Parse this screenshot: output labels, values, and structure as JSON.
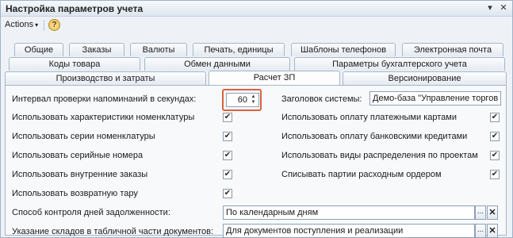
{
  "window": {
    "title": "Настройка параметров учета",
    "pin_icon": "pin-icon",
    "close_icon": "close-icon"
  },
  "toolbar": {
    "actions_label": "Actions",
    "help_label": "?"
  },
  "tabs_row1": [
    "Общие",
    "Заказы",
    "Валюты",
    "Печать, единицы",
    "Шаблоны телефонов",
    "Электронная почта"
  ],
  "tabs_row2": [
    "Коды товара",
    "Обмен данными",
    "Параметры бухгалтерского учета"
  ],
  "tabs_row3": [
    "Производство и затраты",
    "Расчет ЗП",
    "Версионирование"
  ],
  "form": {
    "reminder_interval_label": "Интервал проверки напоминаний в секундах:",
    "reminder_interval_value": "60",
    "system_title_label": "Заголовок системы:",
    "system_title_value": "Демо-база \"Управление торгов",
    "left_checks": [
      {
        "label": "Использовать характеристики номенклатуры",
        "checked": true
      },
      {
        "label": "Использовать серии номенклатуры",
        "checked": true
      },
      {
        "label": "Использовать серийные номера",
        "checked": true
      },
      {
        "label": "Использовать внутренние заказы",
        "checked": true
      },
      {
        "label": "Использовать возвратную тару",
        "checked": true
      }
    ],
    "right_checks": [
      {
        "label": "Использовать оплату платежными картами",
        "checked": true
      },
      {
        "label": "Использовать оплату банковскими кредитами",
        "checked": true
      },
      {
        "label": "Использовать виды распределения по проектам",
        "checked": true
      },
      {
        "label": "Списывать партии расходным ордером",
        "checked": true
      }
    ],
    "debt_control_label": "Способ контроля дней задолженности:",
    "debt_control_value": "По календарным дням",
    "warehouse_label": "Указание складов в табличной части документов:",
    "warehouse_value": "Для документов поступления и реализации",
    "select_glyph": "...",
    "clear_glyph": "✕",
    "check_glyph": "✔"
  }
}
